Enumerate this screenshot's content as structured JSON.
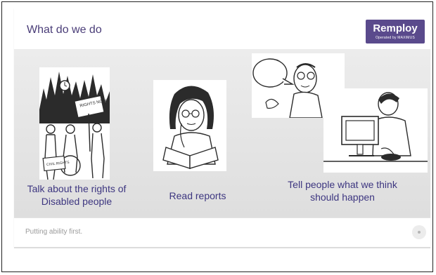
{
  "slide": {
    "title": "What do we do",
    "logo": {
      "name": "Remploy",
      "tagline": "Operated by MAXIMUS"
    },
    "items": [
      {
        "caption": "Talk about the rights of Disabled people",
        "illustration": "protest-icon",
        "sign_text": "RIGHTS NOW",
        "banner_text": "CIVIL RIGHTS"
      },
      {
        "caption": "Read reports",
        "illustration": "reading-icon"
      },
      {
        "caption": "Tell people what we think should happen",
        "illustration": "speech-and-computer-icon"
      }
    ],
    "footer": {
      "text": "Putting ability first."
    }
  }
}
